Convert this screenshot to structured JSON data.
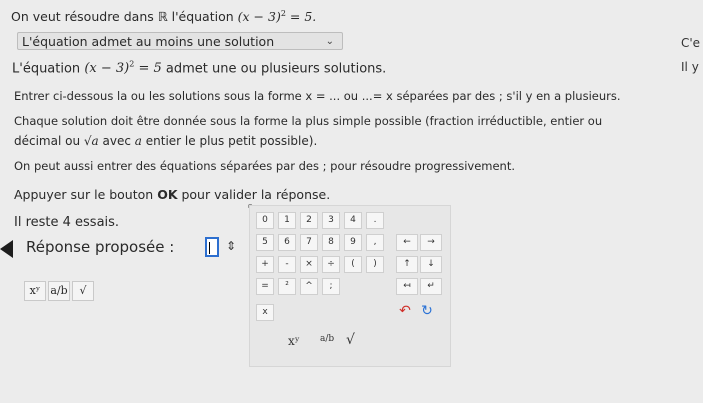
{
  "question": {
    "prefix": "On veut résoudre dans ℝ l'équation",
    "eq_lhs": "(x − 3)",
    "eq_exp": "2",
    "eq_rhs": " = 5."
  },
  "dropdown": {
    "selected": "L'équation admet au moins une solution",
    "chevron": "⌄"
  },
  "side": {
    "top": "C'e",
    "mid": "Il y"
  },
  "statement": {
    "prefix": "L'équation",
    "eq_lhs": "(x − 3)",
    "eq_exp": "2",
    "eq_rhs": " = 5",
    "suffix": " admet une ou plusieurs solutions."
  },
  "instructions": {
    "line1": "Entrer ci-dessous la ou les solutions sous la forme x = ... ou ...= x séparées par des ; s'il y en a plusieurs.",
    "line2": "Chaque solution doit être donnée sous la forme la plus simple possible (fraction irréductible, entier ou",
    "line3_prefix": "décimal ou",
    "sqrt_symbol": "√a",
    "line3_mid": " avec ",
    "line3_var": "a",
    "line3_suffix": " entier le plus petit possible).",
    "line4": "On peut aussi entrer des équations séparées par des ; pour résoudre progressivement.",
    "line5_prefix": "Appuyer sur le bouton ",
    "line5_ok": "OK",
    "line5_suffix": " pour valider la réponse."
  },
  "attempts": "Il reste 4 essais.",
  "answer": {
    "label": "Réponse proposée :",
    "value": ""
  },
  "tools": {
    "power": "xʸ",
    "fraction": "a/b",
    "sqrt": "√"
  },
  "keypad": {
    "row1": [
      "0",
      "1",
      "2",
      "3",
      "4",
      "."
    ],
    "row2": [
      "5",
      "6",
      "7",
      "8",
      "9",
      ","
    ],
    "row3": [
      "+",
      "-",
      "×",
      "÷",
      "(",
      ")"
    ],
    "row4": [
      "=",
      "²",
      "^",
      ";"
    ],
    "nav_row2": [
      "←",
      "→"
    ],
    "nav_row3": [
      "↑",
      "↓"
    ],
    "nav_row4": [
      "↤",
      "↵"
    ],
    "x_key": "x",
    "undo": "↶",
    "redo": "↻",
    "power": "xʸ",
    "fraction": "a/b",
    "sqrt": "√"
  }
}
